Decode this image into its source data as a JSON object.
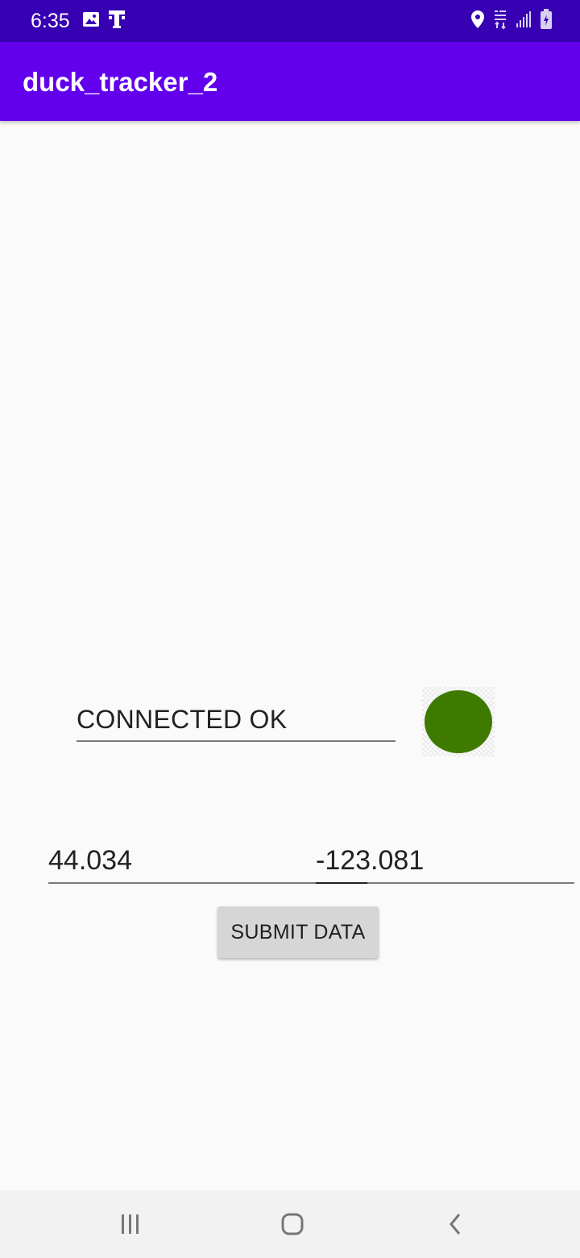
{
  "status_bar": {
    "time": "6:35",
    "icons": [
      "image-icon",
      "t-mobile-icon",
      "location-icon",
      "lte-icon",
      "signal-icon",
      "battery-icon"
    ],
    "background": "#3700b3"
  },
  "app_bar": {
    "title": "duck_tracker_2",
    "background": "#6200ee"
  },
  "connection": {
    "status_text": "CONNECTED OK",
    "indicator_color": "#3f7a00"
  },
  "coordinates": {
    "latitude": "44.034",
    "longitude": "-123.081"
  },
  "actions": {
    "submit_label": "SUBMIT DATA"
  },
  "nav_bar": {
    "buttons": [
      "recent-apps-icon",
      "home-icon",
      "back-icon"
    ]
  }
}
